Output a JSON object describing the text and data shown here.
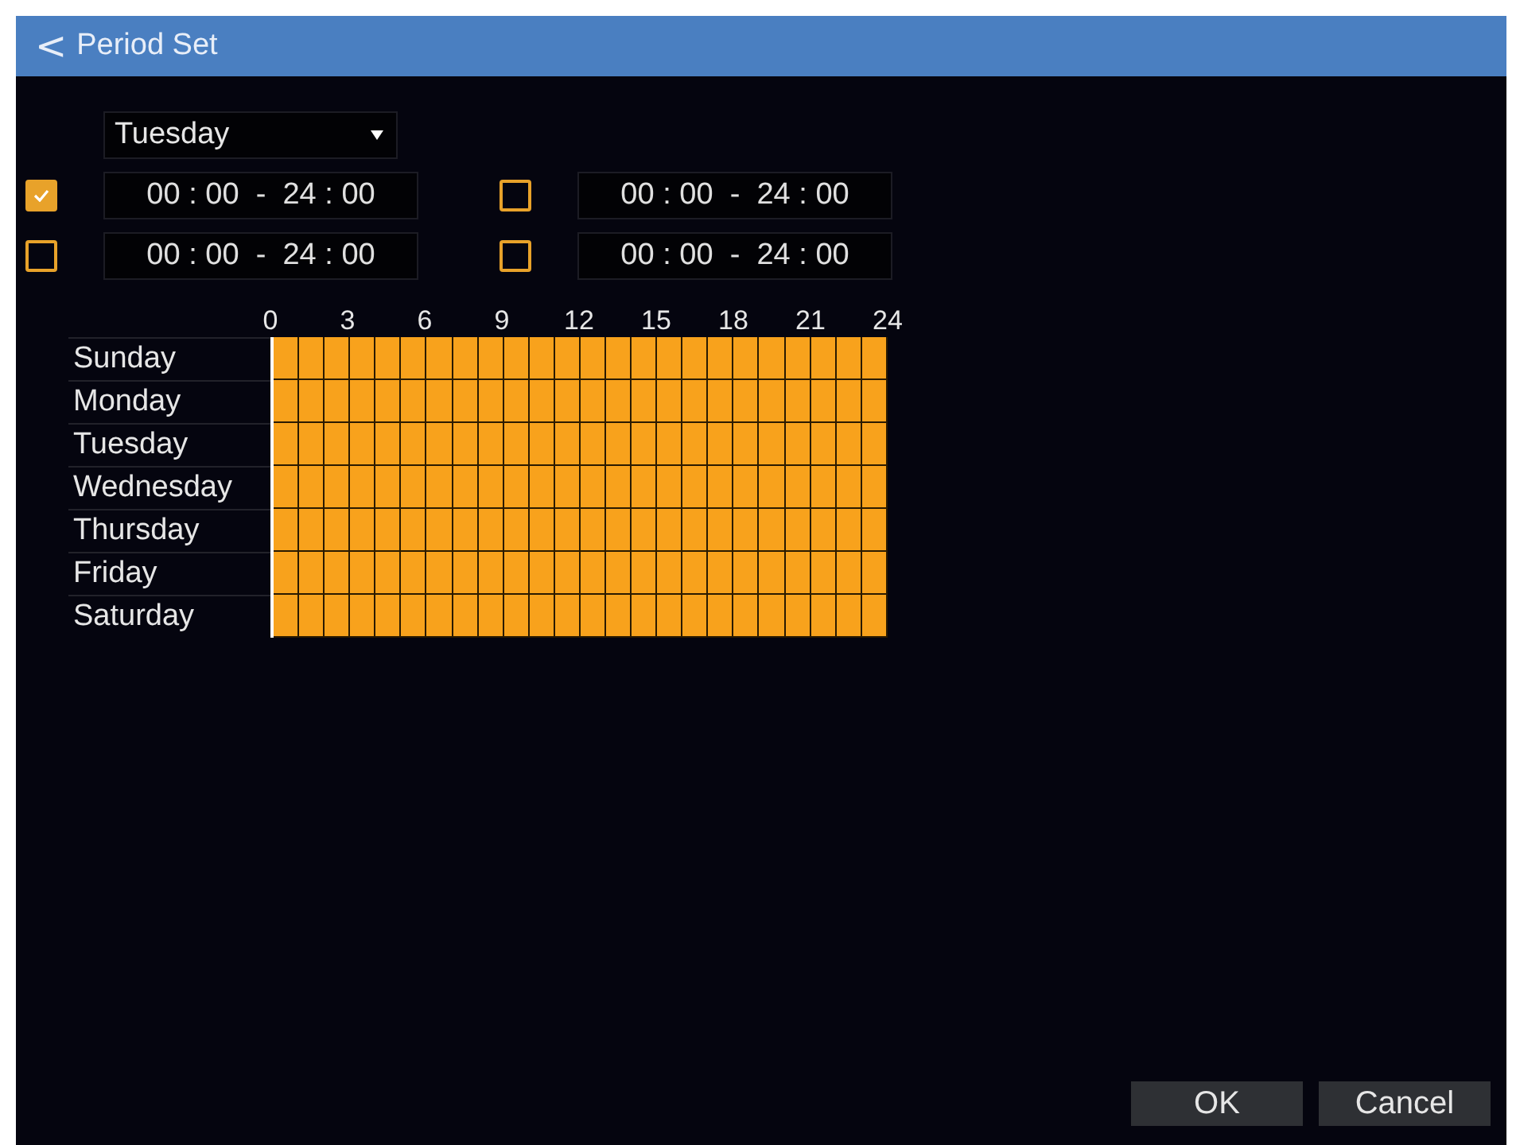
{
  "header": {
    "back": "<",
    "title": "Period Set"
  },
  "day_select": {
    "value": "Tuesday"
  },
  "periods": [
    {
      "checked": true,
      "value": "00 : 00  -  24 : 00"
    },
    {
      "checked": false,
      "value": "00 : 00  -  24 : 00"
    },
    {
      "checked": false,
      "value": "00 : 00  -  24 : 00"
    },
    {
      "checked": false,
      "value": "00 : 00  -  24 : 00"
    }
  ],
  "hour_labels": [
    "0",
    "3",
    "6",
    "9",
    "12",
    "15",
    "18",
    "21",
    "24"
  ],
  "days": [
    {
      "name": "Sunday",
      "slots": [
        true,
        true,
        true,
        true,
        true,
        true,
        true,
        true,
        true,
        true,
        true,
        true,
        true,
        true,
        true,
        true,
        true,
        true,
        true,
        true,
        true,
        true,
        true,
        true
      ]
    },
    {
      "name": "Monday",
      "slots": [
        true,
        true,
        true,
        true,
        true,
        true,
        true,
        true,
        true,
        true,
        true,
        true,
        true,
        true,
        true,
        true,
        true,
        true,
        true,
        true,
        true,
        true,
        true,
        true
      ]
    },
    {
      "name": "Tuesday",
      "slots": [
        true,
        true,
        true,
        true,
        true,
        true,
        true,
        true,
        true,
        true,
        true,
        true,
        true,
        true,
        true,
        true,
        true,
        true,
        true,
        true,
        true,
        true,
        true,
        true
      ]
    },
    {
      "name": "Wednesday",
      "slots": [
        true,
        true,
        true,
        true,
        true,
        true,
        true,
        true,
        true,
        true,
        true,
        true,
        true,
        true,
        true,
        true,
        true,
        true,
        true,
        true,
        true,
        true,
        true,
        true
      ]
    },
    {
      "name": "Thursday",
      "slots": [
        true,
        true,
        true,
        true,
        true,
        true,
        true,
        true,
        true,
        true,
        true,
        true,
        true,
        true,
        true,
        true,
        true,
        true,
        true,
        true,
        true,
        true,
        true,
        true
      ]
    },
    {
      "name": "Friday",
      "slots": [
        true,
        true,
        true,
        true,
        true,
        true,
        true,
        true,
        true,
        true,
        true,
        true,
        true,
        true,
        true,
        true,
        true,
        true,
        true,
        true,
        true,
        true,
        true,
        true
      ]
    },
    {
      "name": "Saturday",
      "slots": [
        true,
        true,
        true,
        true,
        true,
        true,
        true,
        true,
        true,
        true,
        true,
        true,
        true,
        true,
        true,
        true,
        true,
        true,
        true,
        true,
        true,
        true,
        true,
        true
      ]
    }
  ],
  "buttons": [
    "OK",
    "Cancel"
  ]
}
